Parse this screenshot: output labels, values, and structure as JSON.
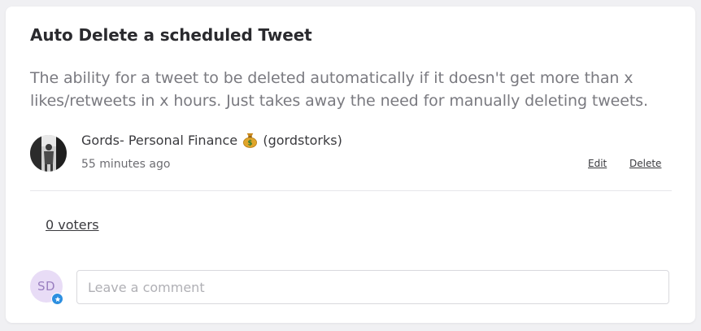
{
  "post": {
    "title": "Auto Delete a scheduled Tweet",
    "description": "The ability for a tweet to be deleted automatically if it doesn't get more than x likes/retweets in x hours. Just takes away the need for manually deleting tweets.",
    "author_name": "Gords- Personal Finance",
    "author_emoji": "money-bag-icon",
    "author_handle": "(gordstorks)",
    "timestamp": "55 minutes ago",
    "edit_label": "Edit",
    "delete_label": "Delete"
  },
  "voters": {
    "label": "0 voters"
  },
  "comment": {
    "user_initials": "SD",
    "placeholder": "Leave a comment",
    "value": ""
  },
  "colors": {
    "card_bg": "#ffffff",
    "page_bg": "#f0f0f3",
    "initials_avatar_bg": "#e8dcf6",
    "initials_color": "#9a7fc0",
    "badge_blue": "#2d8fe0"
  }
}
